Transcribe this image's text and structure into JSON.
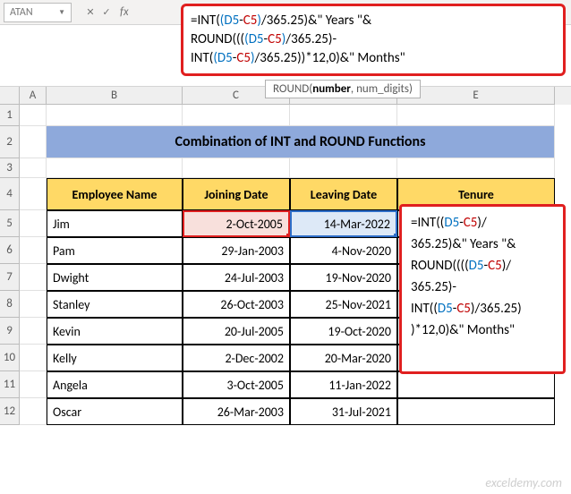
{
  "name_box": "ATAN",
  "formula_bar": {
    "line1_pre": "=INT(",
    "line1_expr_open": "(",
    "d5": "D5",
    "minus": "-",
    "c5": "C5",
    "line1_expr_close": ")",
    "line1_post": "/365.25)&\" Years \"&",
    "line2_pre": "ROUND(((",
    "line2_post": "/365.25)-",
    "line3_pre": "INT(",
    "line3_post": "/365.25))*12,0)&\" Months\""
  },
  "tooltip": {
    "fn": "ROUND(",
    "arg1": "number",
    "rest": ", num_digits)"
  },
  "columns": [
    "A",
    "B",
    "C",
    "D",
    "E"
  ],
  "title": "Combination of INT and ROUND Functions",
  "headers": {
    "b": "Employee Name",
    "c": "Joining Date",
    "d": "Leaving Date",
    "e": "Tenure"
  },
  "rows": [
    {
      "n": "5",
      "name": "Jim",
      "join": "2-Oct-2005",
      "leave": "14-Mar-2022"
    },
    {
      "n": "6",
      "name": "Pam",
      "join": "29-Jan-2003",
      "leave": "4-Nov-2020"
    },
    {
      "n": "7",
      "name": "Dwight",
      "join": "24-Jul-2003",
      "leave": "19-Nov-2020"
    },
    {
      "n": "8",
      "name": "Stanley",
      "join": "26-Oct-2003",
      "leave": "25-Nov-2021"
    },
    {
      "n": "9",
      "name": "Kevin",
      "join": "20-Jul-2005",
      "leave": "19-Oct-2020"
    },
    {
      "n": "10",
      "name": "Kelly",
      "join": "2-Dec-2002",
      "leave": "20-Mar-2020"
    },
    {
      "n": "11",
      "name": "Angela",
      "join": "3-Oct-2005",
      "leave": "11-Jan-2022"
    },
    {
      "n": "12",
      "name": "Oscar",
      "join": "26-Mar-2003",
      "leave": "31-Jul-2021"
    }
  ],
  "row_nums": {
    "r1": "1",
    "r2": "2",
    "r3": "3",
    "r4": "4"
  },
  "cell_formula": "=INT((D5-C5)/365.25)&\" Years \"&ROUND((((D5-C5)/365.25)-INT((D5-C5)/365.25))*12,0)&\" Months\"",
  "watermark": "exceldemy.com"
}
